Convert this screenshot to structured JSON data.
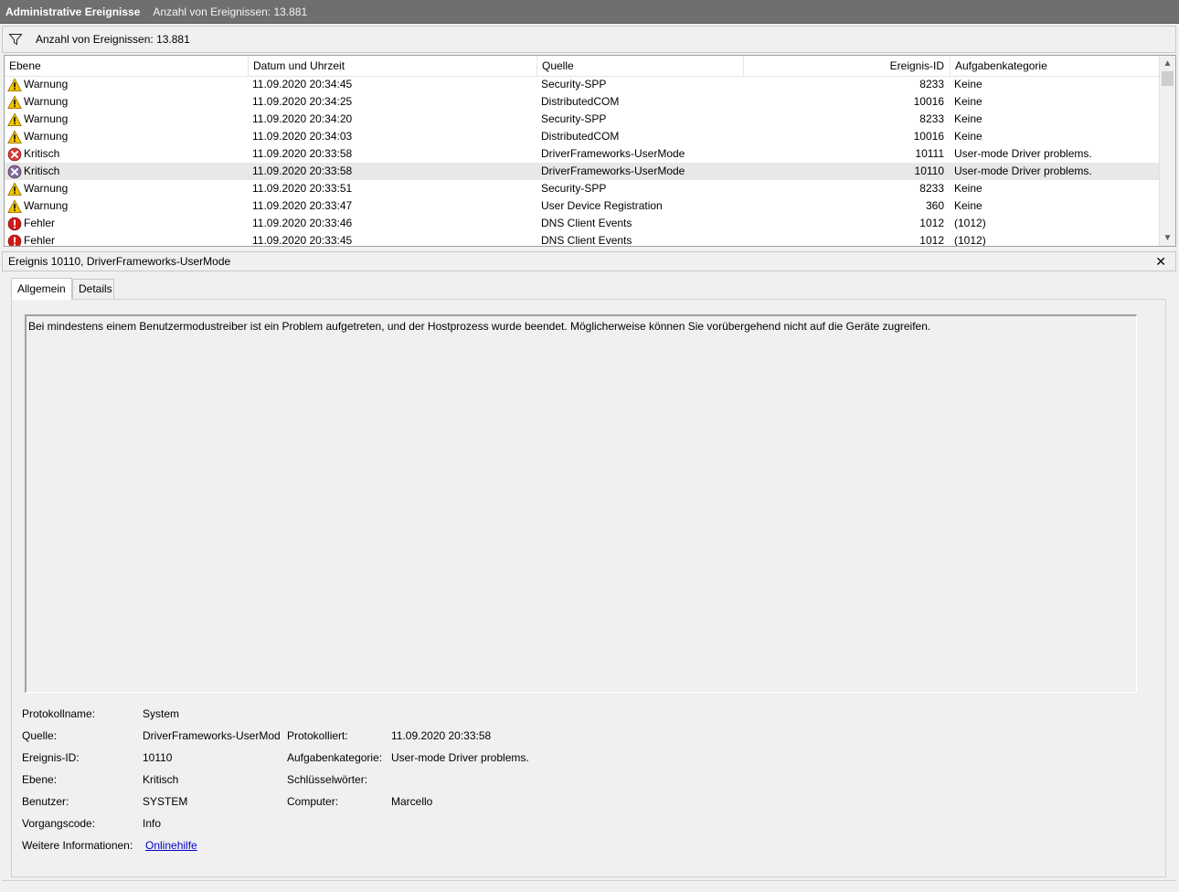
{
  "titlebar": {
    "title": "Administrative Ereignisse",
    "count_text": "Anzahl von Ereignissen: 13.881"
  },
  "filterbar": {
    "icon": "filter-icon",
    "text": "Anzahl von Ereignissen: 13.881"
  },
  "grid": {
    "columns": {
      "level": "Ebene",
      "date": "Datum und Uhrzeit",
      "source": "Quelle",
      "id": "Ereignis-ID",
      "category": "Aufgabenkategorie"
    },
    "rows": [
      {
        "level": "Warnung",
        "icon": "warning-icon",
        "date": "11.09.2020 20:34:45",
        "source": "Security-SPP",
        "id": "8233",
        "category": "Keine"
      },
      {
        "level": "Warnung",
        "icon": "warning-icon",
        "date": "11.09.2020 20:34:25",
        "source": "DistributedCOM",
        "id": "10016",
        "category": "Keine"
      },
      {
        "level": "Warnung",
        "icon": "warning-icon",
        "date": "11.09.2020 20:34:20",
        "source": "Security-SPP",
        "id": "8233",
        "category": "Keine"
      },
      {
        "level": "Warnung",
        "icon": "warning-icon",
        "date": "11.09.2020 20:34:03",
        "source": "DistributedCOM",
        "id": "10016",
        "category": "Keine"
      },
      {
        "level": "Kritisch",
        "icon": "critical-icon",
        "date": "11.09.2020 20:33:58",
        "source": "DriverFrameworks-UserMode",
        "id": "10111",
        "category": "User-mode Driver problems."
      },
      {
        "level": "Kritisch",
        "icon": "critical-icon",
        "date": "11.09.2020 20:33:58",
        "source": "DriverFrameworks-UserMode",
        "id": "10110",
        "category": "User-mode Driver problems.",
        "selected": true
      },
      {
        "level": "Warnung",
        "icon": "warning-icon",
        "date": "11.09.2020 20:33:51",
        "source": "Security-SPP",
        "id": "8233",
        "category": "Keine"
      },
      {
        "level": "Warnung",
        "icon": "warning-icon",
        "date": "11.09.2020 20:33:47",
        "source": "User Device Registration",
        "id": "360",
        "category": "Keine"
      },
      {
        "level": "Fehler",
        "icon": "error-icon",
        "date": "11.09.2020 20:33:46",
        "source": "DNS Client Events",
        "id": "1012",
        "category": "(1012)"
      },
      {
        "level": "Fehler",
        "icon": "error-icon",
        "date": "11.09.2020 20:33:45",
        "source": "DNS Client Events",
        "id": "1012",
        "category": "(1012)"
      }
    ]
  },
  "detail": {
    "header": "Ereignis 10110, DriverFrameworks-UserMode",
    "close": "✕",
    "tabs": [
      "Allgemein",
      "Details"
    ],
    "description": "Bei mindestens einem Benutzermodustreiber ist ein Problem aufgetreten, und der Hostprozess wurde beendet. Möglicherweise können Sie vorübergehend nicht auf die Geräte zugreifen.",
    "props": {
      "log_name_label": "Protokollname:",
      "log_name": "System",
      "source_label": "Quelle:",
      "source": "DriverFrameworks-UserMod",
      "logged_label": "Protokolliert:",
      "logged": "11.09.2020 20:33:58",
      "event_id_label": "Ereignis-ID:",
      "event_id": "10110",
      "task_cat_label": "Aufgabenkategorie:",
      "task_cat": "User-mode Driver problems.",
      "level_label": "Ebene:",
      "level": "Kritisch",
      "keywords_label": "Schlüsselwörter:",
      "keywords": "",
      "user_label": "Benutzer:",
      "user": "SYSTEM",
      "computer_label": "Computer:",
      "computer": "Marcello",
      "opcode_label": "Vorgangscode:",
      "opcode": "Info",
      "more_info_label": "Weitere Informationen:",
      "more_info_link": "Onlinehilfe"
    }
  },
  "colors": {
    "titlebar": "#6f6f6f",
    "selection": "#e8e8e8",
    "warning": "#f5c400",
    "critical": "#d83b3b",
    "critical_selected": "#7c6aa6",
    "error": "#d01818",
    "link": "#0000cc"
  }
}
